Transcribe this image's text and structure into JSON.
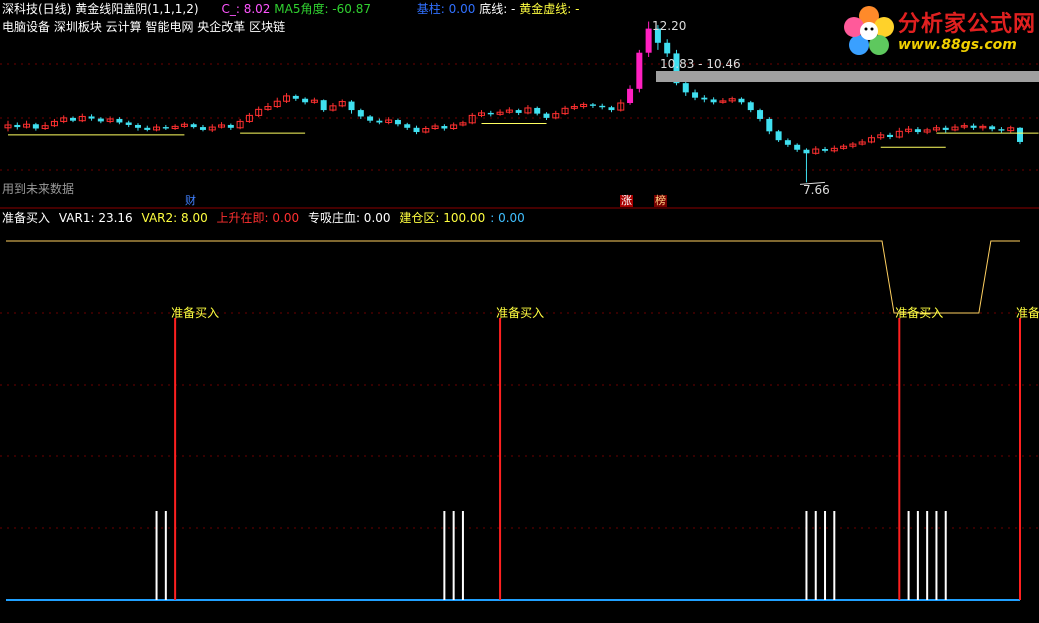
{
  "header": {
    "stock": "深科技(日线)",
    "indicator": "黄金线阳盖阴(1,1,1,2)",
    "c_label": "C_: 8.02",
    "ma5_label": "MA5角度: -60.87",
    "base_label": "基柱: 0.00",
    "bottom_line_label": "底线: -",
    "golden_dashed_label": "黄金虚线: -"
  },
  "sectors": "电脑设备 深圳板块 云计算 智能电网 央企改革 区块链",
  "future_data": "用到未来数据",
  "markers": {
    "cai": "财",
    "zhang": "涨",
    "bang": "榜"
  },
  "price_labels": {
    "high": "12.20",
    "range": "10.83 - 10.46",
    "low": "7.66"
  },
  "lower": {
    "name": "准备买入",
    "var1": "VAR1: 23.16",
    "var2": "VAR2: 8.00",
    "rise": "上升在即: 0.00",
    "absorb": "专吸庄血: 0.00",
    "build": "建仓区: 100.00",
    "extra": ": 0.00",
    "signal_label": "准备买入"
  },
  "logo": {
    "title": "分析家公式网",
    "url": "www.88gs.com"
  },
  "colors": {
    "up": "#ff3030",
    "down": "#40e0f0",
    "bg": "#000000",
    "axis": "#8b0000"
  },
  "candles": [
    [
      9.2,
      9.28,
      9.4,
      9.1
    ],
    [
      9.28,
      9.22,
      9.35,
      9.15
    ],
    [
      9.22,
      9.3,
      9.4,
      9.18
    ],
    [
      9.3,
      9.18,
      9.34,
      9.12
    ],
    [
      9.18,
      9.26,
      9.36,
      9.14
    ],
    [
      9.26,
      9.38,
      9.45,
      9.22
    ],
    [
      9.38,
      9.48,
      9.55,
      9.33
    ],
    [
      9.48,
      9.4,
      9.52,
      9.36
    ],
    [
      9.4,
      9.52,
      9.6,
      9.36
    ],
    [
      9.52,
      9.46,
      9.58,
      9.4
    ],
    [
      9.46,
      9.38,
      9.5,
      9.33
    ],
    [
      9.38,
      9.45,
      9.52,
      9.33
    ],
    [
      9.45,
      9.35,
      9.5,
      9.3
    ],
    [
      9.35,
      9.28,
      9.4,
      9.22
    ],
    [
      9.28,
      9.2,
      9.33,
      9.12
    ],
    [
      9.2,
      9.14,
      9.26,
      9.1
    ],
    [
      9.14,
      9.22,
      9.3,
      9.1
    ],
    [
      9.22,
      9.18,
      9.28,
      9.14
    ],
    [
      9.18,
      9.24,
      9.3,
      9.14
    ],
    [
      9.24,
      9.3,
      9.36,
      9.2
    ],
    [
      9.3,
      9.22,
      9.34,
      9.18
    ],
    [
      9.22,
      9.14,
      9.28,
      9.1
    ],
    [
      9.14,
      9.22,
      9.3,
      9.08
    ],
    [
      9.22,
      9.28,
      9.36,
      9.18
    ],
    [
      9.28,
      9.2,
      9.32,
      9.14
    ],
    [
      9.2,
      9.38,
      9.45,
      9.16
    ],
    [
      9.38,
      9.55,
      9.62,
      9.34
    ],
    [
      9.55,
      9.72,
      9.8,
      9.5
    ],
    [
      9.72,
      9.8,
      9.9,
      9.68
    ],
    [
      9.8,
      9.95,
      10.05,
      9.76
    ],
    [
      9.95,
      10.1,
      10.18,
      9.9
    ],
    [
      10.1,
      10.02,
      10.14,
      9.96
    ],
    [
      10.02,
      9.92,
      10.06,
      9.86
    ],
    [
      9.92,
      9.98,
      10.05,
      9.88
    ],
    [
      9.98,
      9.7,
      10.0,
      9.65
    ],
    [
      9.7,
      9.82,
      9.9,
      9.66
    ],
    [
      9.82,
      9.94,
      10.0,
      9.78
    ],
    [
      9.94,
      9.7,
      9.98,
      9.6
    ],
    [
      9.7,
      9.52,
      9.74,
      9.45
    ],
    [
      9.52,
      9.4,
      9.56,
      9.34
    ],
    [
      9.4,
      9.35,
      9.46,
      9.3
    ],
    [
      9.35,
      9.42,
      9.5,
      9.3
    ],
    [
      9.42,
      9.3,
      9.46,
      9.24
    ],
    [
      9.3,
      9.2,
      9.34,
      9.14
    ],
    [
      9.2,
      9.08,
      9.26,
      9.02
    ],
    [
      9.08,
      9.18,
      9.25,
      9.04
    ],
    [
      9.18,
      9.25,
      9.32,
      9.14
    ],
    [
      9.25,
      9.18,
      9.3,
      9.12
    ],
    [
      9.18,
      9.28,
      9.35,
      9.14
    ],
    [
      9.28,
      9.34,
      9.4,
      9.24
    ],
    [
      9.34,
      9.55,
      9.62,
      9.3
    ],
    [
      9.55,
      9.62,
      9.7,
      9.5
    ],
    [
      9.62,
      9.58,
      9.68,
      9.52
    ],
    [
      9.58,
      9.64,
      9.72,
      9.54
    ],
    [
      9.64,
      9.7,
      9.78,
      9.6
    ],
    [
      9.7,
      9.62,
      9.74,
      9.56
    ],
    [
      9.62,
      9.76,
      9.84,
      9.58
    ],
    [
      9.76,
      9.6,
      9.8,
      9.55
    ],
    [
      9.6,
      9.48,
      9.64,
      9.42
    ],
    [
      9.48,
      9.6,
      9.68,
      9.44
    ],
    [
      9.6,
      9.75,
      9.82,
      9.56
    ],
    [
      9.75,
      9.8,
      9.88,
      9.7
    ],
    [
      9.8,
      9.86,
      9.92,
      9.74
    ],
    [
      9.86,
      9.82,
      9.9,
      9.76
    ],
    [
      9.82,
      9.78,
      9.88,
      9.72
    ],
    [
      9.78,
      9.7,
      9.82,
      9.64
    ],
    [
      9.7,
      9.9,
      10.0,
      9.66
    ],
    [
      9.9,
      10.3,
      10.4,
      9.85
    ],
    [
      10.3,
      11.32,
      11.4,
      10.2
    ],
    [
      11.32,
      12.0,
      12.2,
      11.2
    ],
    [
      12.0,
      11.6,
      12.1,
      11.4
    ],
    [
      11.6,
      11.3,
      11.7,
      11.2
    ],
    [
      11.3,
      10.46,
      11.4,
      10.4
    ],
    [
      10.46,
      10.2,
      10.55,
      10.1
    ],
    [
      10.2,
      10.05,
      10.28,
      9.98
    ],
    [
      10.05,
      10.0,
      10.12,
      9.92
    ],
    [
      10.0,
      9.92,
      10.06,
      9.86
    ],
    [
      9.92,
      9.96,
      10.04,
      9.88
    ],
    [
      9.96,
      10.02,
      10.08,
      9.9
    ],
    [
      10.02,
      9.92,
      10.06,
      9.86
    ],
    [
      9.92,
      9.7,
      9.96,
      9.64
    ],
    [
      9.7,
      9.45,
      9.74,
      9.38
    ],
    [
      9.45,
      9.1,
      9.5,
      9.02
    ],
    [
      9.1,
      8.85,
      9.14,
      8.8
    ],
    [
      8.85,
      8.72,
      8.9,
      8.66
    ],
    [
      8.72,
      8.58,
      8.76,
      8.52
    ],
    [
      8.58,
      8.48,
      8.62,
      7.66
    ],
    [
      8.48,
      8.6,
      8.68,
      8.44
    ],
    [
      8.6,
      8.55,
      8.66,
      8.5
    ],
    [
      8.55,
      8.62,
      8.7,
      8.5
    ],
    [
      8.62,
      8.68,
      8.74,
      8.58
    ],
    [
      8.68,
      8.74,
      8.8,
      8.62
    ],
    [
      8.74,
      8.8,
      8.88,
      8.7
    ],
    [
      8.8,
      8.92,
      9.0,
      8.76
    ],
    [
      8.92,
      9.0,
      9.08,
      8.86
    ],
    [
      9.0,
      8.94,
      9.06,
      8.88
    ],
    [
      8.94,
      9.1,
      9.2,
      8.9
    ],
    [
      9.1,
      9.16,
      9.25,
      9.04
    ],
    [
      9.16,
      9.08,
      9.22,
      9.02
    ],
    [
      9.08,
      9.14,
      9.2,
      9.02
    ],
    [
      9.14,
      9.2,
      9.28,
      9.08
    ],
    [
      9.2,
      9.14,
      9.26,
      9.06
    ],
    [
      9.14,
      9.22,
      9.3,
      9.1
    ],
    [
      9.22,
      9.26,
      9.34,
      9.16
    ],
    [
      9.26,
      9.2,
      9.32,
      9.14
    ],
    [
      9.2,
      9.24,
      9.3,
      9.12
    ],
    [
      9.24,
      9.16,
      9.28,
      9.1
    ],
    [
      9.16,
      9.12,
      9.22,
      9.06
    ],
    [
      9.12,
      9.2,
      9.26,
      9.06
    ],
    [
      9.2,
      8.8,
      9.22,
      8.74
    ]
  ],
  "signals": {
    "buy_index": [
      18,
      53,
      96,
      109
    ],
    "white_bars": [
      [
        16,
        17
      ],
      [
        47,
        48,
        49
      ],
      [
        86,
        87,
        88,
        89
      ],
      [
        97,
        98,
        99,
        100,
        101
      ]
    ]
  },
  "yellow_line_low_segment": [
    95,
    105
  ]
}
